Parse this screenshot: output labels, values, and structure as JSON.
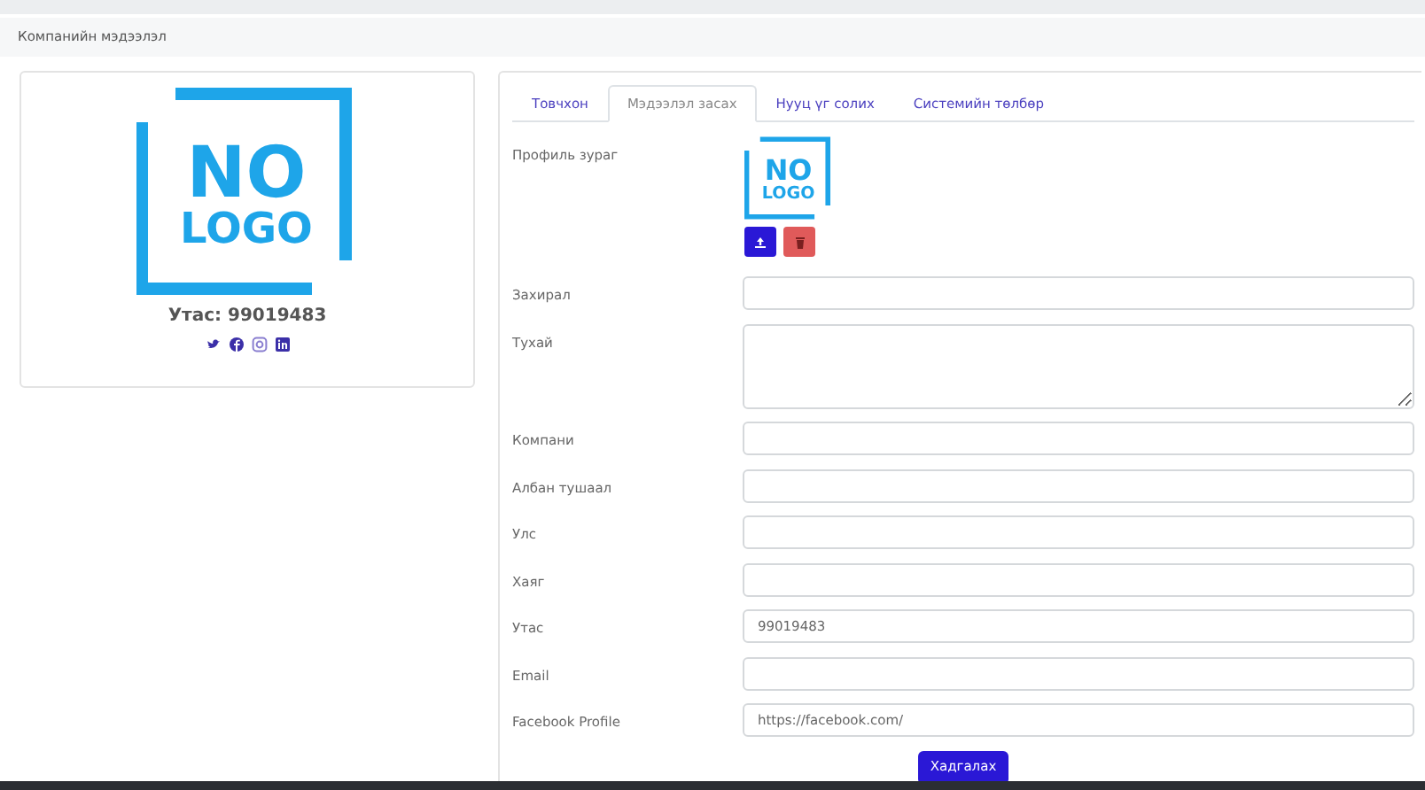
{
  "header": {
    "title": "Компанийн мэдээлэл"
  },
  "profile_card": {
    "logo_text": [
      "NO",
      "LOGO"
    ],
    "phone": "Утас: 99019483",
    "social": [
      {
        "kind": "twitter"
      },
      {
        "kind": "facebook"
      },
      {
        "kind": "instagram"
      },
      {
        "kind": "linkedin"
      }
    ]
  },
  "tabs": [
    {
      "label": "Товчхон",
      "selected": false
    },
    {
      "label": "Мэдээлэл засах",
      "selected": true
    },
    {
      "label": "Нууц үг солих",
      "selected": false
    },
    {
      "label": "Системийн төлбөр",
      "selected": false
    }
  ],
  "form": {
    "avatar_label": "Профиль зураг",
    "avatar_logo_text": [
      "NO",
      "LOGO"
    ],
    "fields": [
      {
        "label": "Захирал",
        "kind": "input"
      },
      {
        "label": "Тухай",
        "kind": "textarea"
      },
      {
        "label": "Компани",
        "kind": "input"
      },
      {
        "label": "Албан тушаал",
        "kind": "input"
      },
      {
        "label": "Улс",
        "kind": "input"
      },
      {
        "label": "Хаяг",
        "kind": "input"
      },
      {
        "label": "Утас",
        "kind": "input",
        "value": "99019483"
      },
      {
        "label": "Email",
        "kind": "input"
      },
      {
        "label": "Facebook Profile",
        "kind": "input",
        "value": "https://facebook.com/"
      }
    ],
    "save_button": "Хадгалах"
  }
}
